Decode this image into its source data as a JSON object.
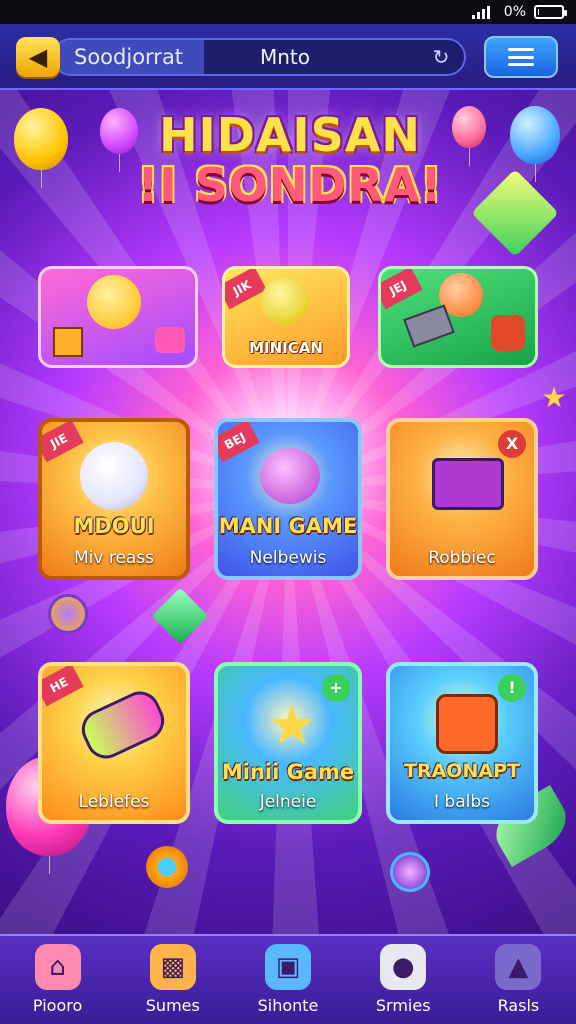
{
  "status_bar": {
    "battery_text": "0%",
    "battery_level_percent": 5,
    "signal_bars": 4
  },
  "top_bar": {
    "search_left_text": "Soodjorrat",
    "search_center_text": "Mnto"
  },
  "title": {
    "line1": "HIDAISAN",
    "line2": "!I SONDRA!"
  },
  "featured_cards": [
    {
      "label": "",
      "badge": "",
      "color_from": "#ff6ad6",
      "color_to": "#a34bff"
    },
    {
      "label": "MINICAN",
      "badge": "JIK",
      "color_from": "#ffe85c",
      "color_to": "#ff9a2a"
    },
    {
      "label": "",
      "badge": "JEJ",
      "color_from": "#4ee07a",
      "color_to": "#1aa34a"
    }
  ],
  "game_cards": [
    {
      "title": "MDOUI",
      "subtitle": "Miv reass",
      "badge": "JIE",
      "corner": "",
      "color_from": "#ffc247",
      "color_to": "#f07a16"
    },
    {
      "title": "MANI GAME",
      "subtitle": "Nelbewis",
      "badge": "BEJ",
      "corner": "",
      "color_from": "#5a9aff",
      "color_to": "#3f54e8"
    },
    {
      "title": "",
      "subtitle": "Robbiec",
      "badge": "",
      "corner": "X",
      "color_from": "#ffb347",
      "color_to": "#f07a16"
    },
    {
      "title": "",
      "subtitle": "Leblefes",
      "badge": "HE",
      "corner": "",
      "color_from": "#ffd24a",
      "color_to": "#ff8a1a"
    },
    {
      "title": "Minii Game",
      "subtitle": "Jelneie",
      "badge": "",
      "corner": "+",
      "color_from": "#4ab8ff",
      "color_to": "#3fd07a"
    },
    {
      "title": "TRAONAPT",
      "subtitle": "I balbs",
      "badge": "",
      "corner": "!",
      "color_from": "#5ad0ff",
      "color_to": "#2a7ae0"
    }
  ],
  "bottom_nav": [
    {
      "label": "Piooro",
      "icon": "house-icon",
      "color": "#ff8ab0"
    },
    {
      "label": "Sumes",
      "icon": "game-box-icon",
      "color": "#ffb34a"
    },
    {
      "label": "Sihonte",
      "icon": "tv-icon",
      "color": "#5ab8ff"
    },
    {
      "label": "Srmies",
      "icon": "ball-icon",
      "color": "#e8e8f0"
    },
    {
      "label": "Rasls",
      "icon": "ghost-icon",
      "color": "#7a6acc"
    }
  ]
}
